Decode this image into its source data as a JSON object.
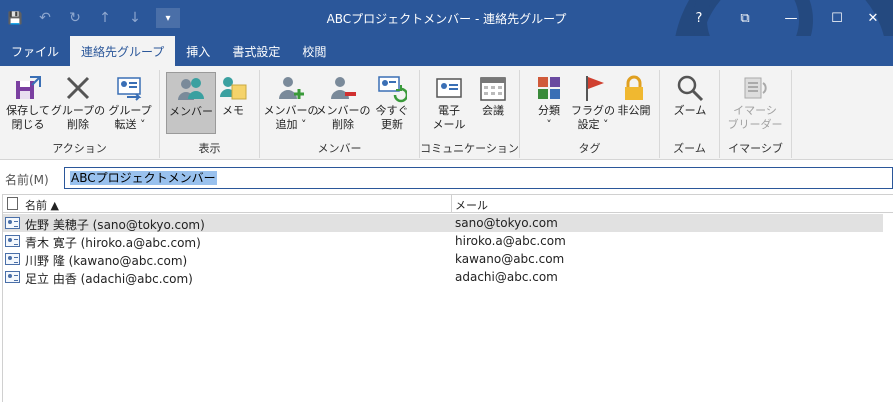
{
  "window": {
    "title": "ABCプロジェクトメンバー  -  連絡先グループ"
  },
  "qat": {
    "save": "💾",
    "undo": "↶",
    "redo": "↻",
    "up": "↑",
    "down": "↓",
    "more": "▾"
  },
  "controls": {
    "help": "?",
    "ribbon_display": "⧉",
    "minimize": "—",
    "maximize": "☐",
    "close": "✕"
  },
  "tabs": [
    "ファイル",
    "連絡先グループ",
    "挿入",
    "書式設定",
    "校閲"
  ],
  "ribbon": {
    "groups": {
      "actions": "アクション",
      "show": "表示",
      "members": "メンバー",
      "communication": "コミュニケーション",
      "tags": "タグ",
      "zoom": "ズーム",
      "immersive": "イマーシブ"
    },
    "buttons": {
      "save_close_1": "保存して",
      "save_close_2": "閉じる",
      "delete_group_1": "グループの",
      "delete_group_2": "削除",
      "forward_group_1": "グループ",
      "forward_group_2": "転送 ˅",
      "members": "メンバー",
      "notes": "メモ",
      "add_members_1": "メンバーの",
      "add_members_2": "追加 ˅",
      "remove_member_1": "メンバーの",
      "remove_member_2": "削除",
      "update_now_1": "今すぐ",
      "update_now_2": "更新",
      "email_1": "電子",
      "email_2": "メール",
      "meeting": "会議",
      "categorize_1": "分類",
      "categorize_2": "˅",
      "follow_up_1": "フラグの",
      "follow_up_2": "設定 ˅",
      "private": "非公開",
      "zoom": "ズーム",
      "immersive_1": "イマーシ",
      "immersive_2": "ブリーダー"
    }
  },
  "name_field": {
    "label": "名前(M)",
    "value": "ABCプロジェクトメンバー"
  },
  "list": {
    "col_name": "名前 ▲",
    "col_mail": "メール",
    "rows": [
      {
        "name": "佐野 美穂子 (sano@tokyo.com)",
        "mail": "sano@tokyo.com"
      },
      {
        "name": "青木 寛子 (hiroko.a@abc.com)",
        "mail": "hiroko.a@abc.com"
      },
      {
        "name": "川野 隆 (kawano@abc.com)",
        "mail": "kawano@abc.com"
      },
      {
        "name": "足立 由香 (adachi@abc.com)",
        "mail": "adachi@abc.com"
      }
    ]
  },
  "colors": {
    "accent": "#2b579a",
    "ribbon_bg": "#f3f3f3",
    "selection": "#99c1ee"
  }
}
